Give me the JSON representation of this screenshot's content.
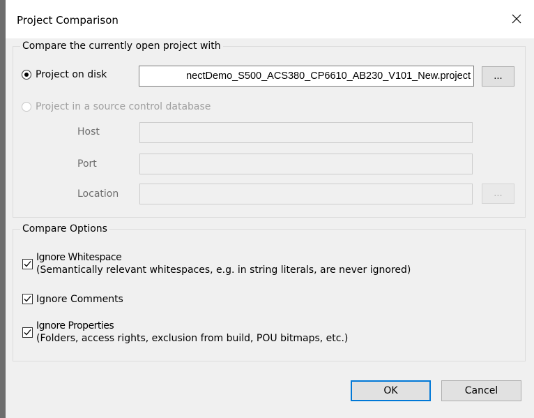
{
  "window": {
    "title": "Project Comparison",
    "close_icon": "close-icon"
  },
  "compare_group": {
    "legend": "Compare the currently open project with",
    "project_on_disk": {
      "label": "Project on disk",
      "checked": true
    },
    "project_path": "nectDemo_S500_ACS380_CP6610_AB230_V101_New.project",
    "browse_label": "...",
    "source_control": {
      "label": "Project in a source control database",
      "enabled": false
    },
    "host_label": "Host",
    "port_label": "Port",
    "location_label": "Location",
    "host_value": "",
    "port_value": "",
    "location_value": "",
    "location_browse_label": "..."
  },
  "options_group": {
    "legend": "Compare Options",
    "ignore_whitespace": {
      "label": "Ignore Whitespace",
      "hint": "(Semantically relevant whitespaces, e.g. in string literals, are never ignored)",
      "checked": true
    },
    "ignore_comments": {
      "label": "Ignore Comments",
      "checked": true
    },
    "ignore_properties": {
      "label": "Ignore Properties",
      "hint": "(Folders, access rights, exclusion from build, POU bitmaps, etc.)",
      "checked": true
    }
  },
  "buttons": {
    "ok": "OK",
    "cancel": "Cancel"
  },
  "colors": {
    "default_button_border": "#0078d7",
    "dialog_background": "#f0f0f0"
  }
}
